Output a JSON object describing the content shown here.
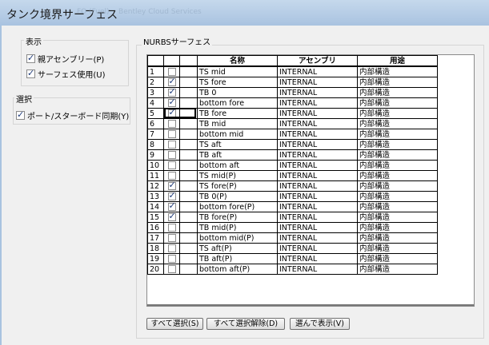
{
  "window": {
    "title": "タンク境界サーフェス",
    "background_tabs": [
      "FO (Fuel)",
      "Bentley Cloud Services"
    ]
  },
  "display_group": {
    "label": "表示",
    "options": [
      {
        "label": "親アセンブリー(P)",
        "checked": true
      },
      {
        "label": "サーフェス使用(U)",
        "checked": true
      }
    ]
  },
  "select_group": {
    "label": "選択",
    "options": [
      {
        "label": "ポート/スターボード同期(Y)",
        "checked": true
      }
    ]
  },
  "nurbs": {
    "label": "NURBSサーフェス",
    "columns": [
      "",
      "",
      "名称",
      "アセンブリ",
      "用途"
    ],
    "rows": [
      {
        "no": "1",
        "checked": false,
        "name": "TS mid",
        "assembly": "INTERNAL",
        "usage": "内部構造"
      },
      {
        "no": "2",
        "checked": true,
        "name": "TS fore",
        "assembly": "INTERNAL",
        "usage": "内部構造"
      },
      {
        "no": "3",
        "checked": true,
        "name": "TB 0",
        "assembly": "INTERNAL",
        "usage": "内部構造"
      },
      {
        "no": "4",
        "checked": true,
        "name": "bottom fore",
        "assembly": "INTERNAL",
        "usage": "内部構造"
      },
      {
        "no": "5",
        "checked": true,
        "name": "TB fore",
        "assembly": "INTERNAL",
        "usage": "内部構造"
      },
      {
        "no": "6",
        "checked": false,
        "name": "TB mid",
        "assembly": "INTERNAL",
        "usage": "内部構造"
      },
      {
        "no": "7",
        "checked": false,
        "name": "bottom mid",
        "assembly": "INTERNAL",
        "usage": "内部構造"
      },
      {
        "no": "8",
        "checked": false,
        "name": "TS aft",
        "assembly": "INTERNAL",
        "usage": "内部構造"
      },
      {
        "no": "9",
        "checked": false,
        "name": "TB aft",
        "assembly": "INTERNAL",
        "usage": "内部構造"
      },
      {
        "no": "10",
        "checked": false,
        "name": "bottom aft",
        "assembly": "INTERNAL",
        "usage": "内部構造"
      },
      {
        "no": "11",
        "checked": false,
        "name": "TS mid(P)",
        "assembly": "INTERNAL",
        "usage": "内部構造"
      },
      {
        "no": "12",
        "checked": true,
        "name": "TS fore(P)",
        "assembly": "INTERNAL",
        "usage": "内部構造"
      },
      {
        "no": "13",
        "checked": true,
        "name": "TB 0(P)",
        "assembly": "INTERNAL",
        "usage": "内部構造"
      },
      {
        "no": "14",
        "checked": true,
        "name": "bottom fore(P)",
        "assembly": "INTERNAL",
        "usage": "内部構造"
      },
      {
        "no": "15",
        "checked": true,
        "name": "TB fore(P)",
        "assembly": "INTERNAL",
        "usage": "内部構造"
      },
      {
        "no": "16",
        "checked": false,
        "name": "TB mid(P)",
        "assembly": "INTERNAL",
        "usage": "内部構造"
      },
      {
        "no": "17",
        "checked": false,
        "name": "bottom mid(P)",
        "assembly": "INTERNAL",
        "usage": "内部構造"
      },
      {
        "no": "18",
        "checked": false,
        "name": "TS aft(P)",
        "assembly": "INTERNAL",
        "usage": "内部構造"
      },
      {
        "no": "19",
        "checked": false,
        "name": "TB aft(P)",
        "assembly": "INTERNAL",
        "usage": "内部構造"
      },
      {
        "no": "20",
        "checked": false,
        "name": "bottom aft(P)",
        "assembly": "INTERNAL",
        "usage": "内部構造"
      }
    ]
  },
  "buttons": {
    "select_all": "すべて選択(S)",
    "deselect_all": "すべて選択解除(D)",
    "select_show": "選んで表示(V)"
  }
}
